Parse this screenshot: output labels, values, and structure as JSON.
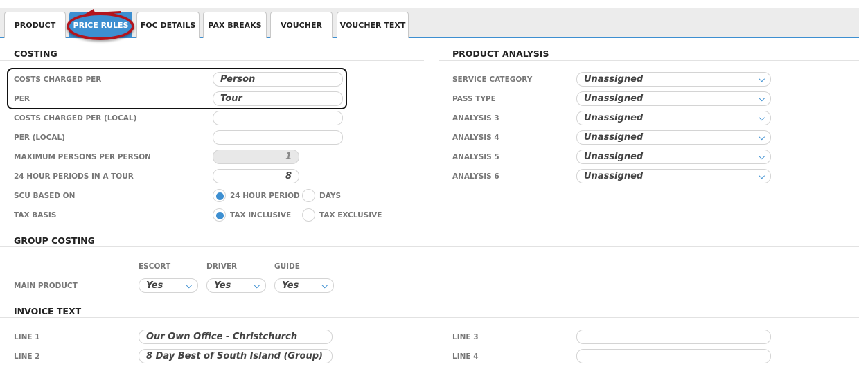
{
  "tabs": [
    "PRODUCT",
    "PRICE RULES",
    "FOC DETAILS",
    "PAX BREAKS",
    "VOUCHER",
    "VOUCHER TEXT"
  ],
  "active_tab": "PRICE RULES",
  "costing": {
    "title": "COSTING",
    "costs_charged_per": {
      "label": "COSTS CHARGED PER",
      "value": "Person"
    },
    "per": {
      "label": "PER",
      "value": "Tour"
    },
    "costs_charged_per_local": {
      "label": "COSTS CHARGED PER (LOCAL)",
      "value": ""
    },
    "per_local": {
      "label": "PER (LOCAL)",
      "value": ""
    },
    "max_persons": {
      "label": "MAXIMUM PERSONS PER PERSON",
      "value": "1"
    },
    "periods": {
      "label": "24 HOUR PERIODS IN A TOUR",
      "value": "8"
    },
    "scu_based_on": {
      "label": "SCU BASED ON",
      "options": [
        "24 HOUR PERIOD",
        "DAYS"
      ],
      "selected": "24 HOUR PERIOD"
    },
    "tax_basis": {
      "label": "TAX BASIS",
      "options": [
        "TAX INCLUSIVE",
        "TAX EXCLUSIVE"
      ],
      "selected": "TAX INCLUSIVE"
    }
  },
  "product_analysis": {
    "title": "PRODUCT ANALYSIS",
    "rows": [
      {
        "label": "SERVICE CATEGORY",
        "value": "Unassigned"
      },
      {
        "label": "PASS TYPE",
        "value": "Unassigned"
      },
      {
        "label": "ANALYSIS 3",
        "value": "Unassigned"
      },
      {
        "label": "ANALYSIS 4",
        "value": "Unassigned"
      },
      {
        "label": "ANALYSIS 5",
        "value": "Unassigned"
      },
      {
        "label": "ANALYSIS 6",
        "value": "Unassigned"
      }
    ]
  },
  "group_costing": {
    "title": "GROUP COSTING",
    "columns": [
      "ESCORT",
      "DRIVER",
      "GUIDE"
    ],
    "row_label": "MAIN PRODUCT",
    "values": [
      "Yes",
      "Yes",
      "Yes"
    ]
  },
  "invoice_text": {
    "title": "INVOICE TEXT",
    "line1": {
      "label": "LINE 1",
      "value": "Our Own Office - Christchurch"
    },
    "line2": {
      "label": "LINE 2",
      "value": "8 Day Best of South Island (Group)"
    },
    "line3": {
      "label": "LINE 3",
      "value": ""
    },
    "line4": {
      "label": "LINE 4",
      "value": ""
    }
  },
  "colors": {
    "accent": "#3d8fd1",
    "annotation": "#b3141c"
  },
  "icons": {
    "select_chevron": "chevron-down-icon"
  }
}
